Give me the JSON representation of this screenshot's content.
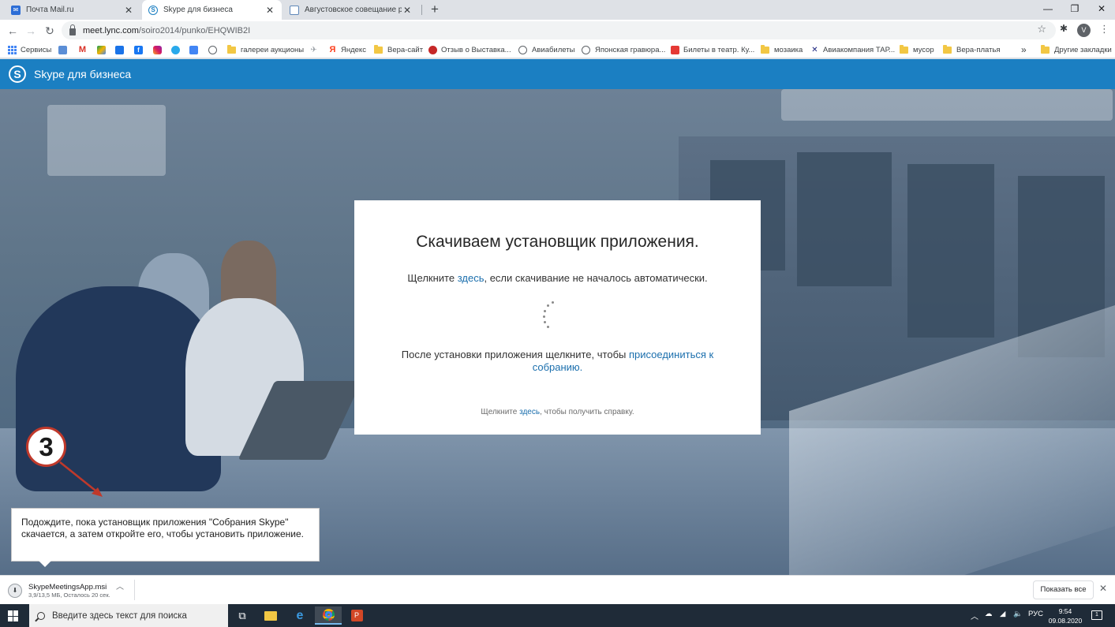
{
  "browser": {
    "tabs": [
      {
        "title": "Почта Mail.ru",
        "favicon": "mail-icon",
        "active": false
      },
      {
        "title": "Skype для бизнеса",
        "favicon": "skype-icon",
        "active": true
      },
      {
        "title": "Августовское совещание работ",
        "favicon": "document-icon",
        "active": false
      }
    ],
    "address": {
      "host": "meet.lync.com",
      "path": "/soiro2014/punko/EHQWIB2I"
    },
    "profile_initial": "V",
    "bookmarks": [
      {
        "label": "Сервисы",
        "icon": "apps-icon"
      },
      {
        "label": "",
        "icon": "finder-icon"
      },
      {
        "label": "",
        "icon": "gmail-icon"
      },
      {
        "label": "",
        "icon": "drive-icon"
      },
      {
        "label": "",
        "icon": "contacts-icon"
      },
      {
        "label": "",
        "icon": "facebook-icon"
      },
      {
        "label": "",
        "icon": "instagram-icon"
      },
      {
        "label": "",
        "icon": "telegram-icon"
      },
      {
        "label": "",
        "icon": "docs-icon"
      },
      {
        "label": "",
        "icon": "globe-icon"
      },
      {
        "label": "галереи аукционы",
        "icon": "folder-icon"
      },
      {
        "label": "",
        "icon": "feather-icon"
      },
      {
        "label": "Яндекс",
        "icon": "yandex-icon"
      },
      {
        "label": "Вера-сайт",
        "icon": "folder-icon"
      },
      {
        "label": "Отзыв о Выставка...",
        "icon": "otzovik-icon"
      },
      {
        "label": "Авиабилеты",
        "icon": "globe-icon"
      },
      {
        "label": "Японская гравюра...",
        "icon": "globe-icon"
      },
      {
        "label": "Билеты в театр. Ку...",
        "icon": "ticket-icon"
      },
      {
        "label": "мозаика",
        "icon": "folder-icon"
      },
      {
        "label": "Авиакомпания ТАР...",
        "icon": "airline-icon"
      },
      {
        "label": "мусор",
        "icon": "folder-icon"
      },
      {
        "label": "Вера-платья",
        "icon": "folder-icon"
      }
    ],
    "bookmarks_overflow": "»",
    "other_bookmarks": "Другие закладки"
  },
  "skype": {
    "title": "Skype для бизнеса",
    "modal": {
      "heading": "Скачиваем установщик приложения.",
      "line1_pre": "Щелкните ",
      "line1_link": "здесь",
      "line1_post": ", если скачивание не началось автоматически.",
      "line2_pre": "После установки приложения щелкните, чтобы ",
      "line2_link": "присоединиться к собранию.",
      "help_pre": "Щелкните ",
      "help_link": "здесь",
      "help_post": ", чтобы получить справку."
    }
  },
  "instruction": {
    "step": "3",
    "text": "Подождите, пока установщик приложения \"Собрания Skype\" скачается, а затем откройте его, чтобы установить приложение."
  },
  "download": {
    "filename": "SkypeMeetingsApp.msi",
    "status": "3,9/13,5 МБ, Осталось 20 сек.",
    "show_all": "Показать все"
  },
  "taskbar": {
    "search_placeholder": "Введите здесь текст для поиска",
    "lang": "РУС",
    "time": "9:54",
    "date": "09.08.2020",
    "notifications": "1"
  },
  "colors": {
    "skype_blue": "#1b7fc2",
    "link": "#1b6fad",
    "step_border": "#c0392b"
  }
}
